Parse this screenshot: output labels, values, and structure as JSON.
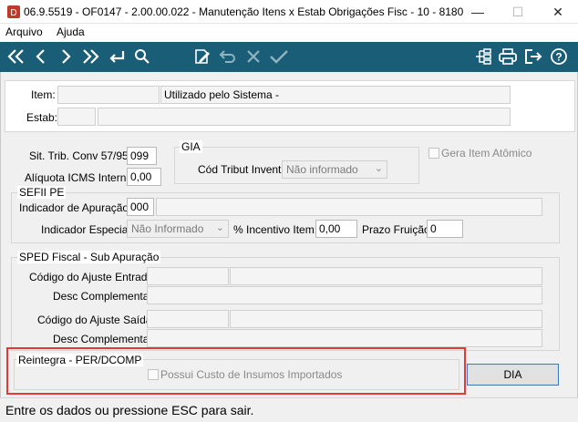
{
  "window": {
    "title": "06.9.5519 - OF0147 - 2.00.00.022 - Manutenção Itens x Estab Obrigações Fisc - 10 - 8180",
    "minimize_glyph": "—",
    "maximize_glyph": "☐",
    "close_glyph": "✕"
  },
  "menu": {
    "items": [
      "Arquivo",
      "Ajuda"
    ]
  },
  "toolbar": {
    "icons": [
      "first-record-icon",
      "previous-record-icon",
      "next-record-icon",
      "last-record-icon",
      "goto-icon",
      "search-icon",
      "edit-icon",
      "undo-icon",
      "cancel-icon",
      "confirm-icon",
      "structure-icon",
      "print-icon",
      "exit-icon",
      "help-icon"
    ],
    "color": "#1a5d76"
  },
  "form": {
    "item_label": "Item:",
    "item_value": "",
    "item_description": "Utilizado pelo Sistema -",
    "estab_label": "Estab:",
    "estab_value": "",
    "estab_description": "",
    "sit_trib_label": "Sit. Trib. Conv 57/95:",
    "sit_trib_value": "099",
    "aliquota_label": "Alíquota ICMS Interna:",
    "aliquota_value": "0,00",
    "gia": {
      "title": "GIA",
      "cod_tribut_label": "Cód Tribut Invent:",
      "cod_tribut_value": "Não informado"
    },
    "gera_item_atomico_label": "Gera Item Atômico",
    "sefii": {
      "title": "SEFII PE",
      "indicador_apuracao_label": "Indicador de Apuração:",
      "indicador_apuracao_value": "000",
      "indicador_apuracao_desc": "",
      "indicador_especial_label": "Indicador Especial:",
      "indicador_especial_value": "Não Informado",
      "incentivo_label": "% Incentivo Item:",
      "incentivo_value": "0,00",
      "prazo_label": "Prazo Fruição:",
      "prazo_value": "0"
    },
    "sped": {
      "title": "SPED Fiscal - Sub Apuração",
      "ajuste_entrada_label": "Código do Ajuste Entrada:",
      "desc_comp1_label": "Desc Complementar:",
      "ajuste_saida_label": "Código do Ajuste Saída:",
      "desc_comp2_label": "Desc Complementar:"
    },
    "reintegra": {
      "title": "Reintegra - PER/DCOMP",
      "possui_custo_label": "Possui Custo de Insumos Importados"
    },
    "dia_button": "DIA"
  },
  "status": {
    "text": "Entre os dados ou pressione ESC para sair."
  },
  "colors": {
    "highlight": "#e03a3a",
    "toolbar": "#1a5d76"
  }
}
